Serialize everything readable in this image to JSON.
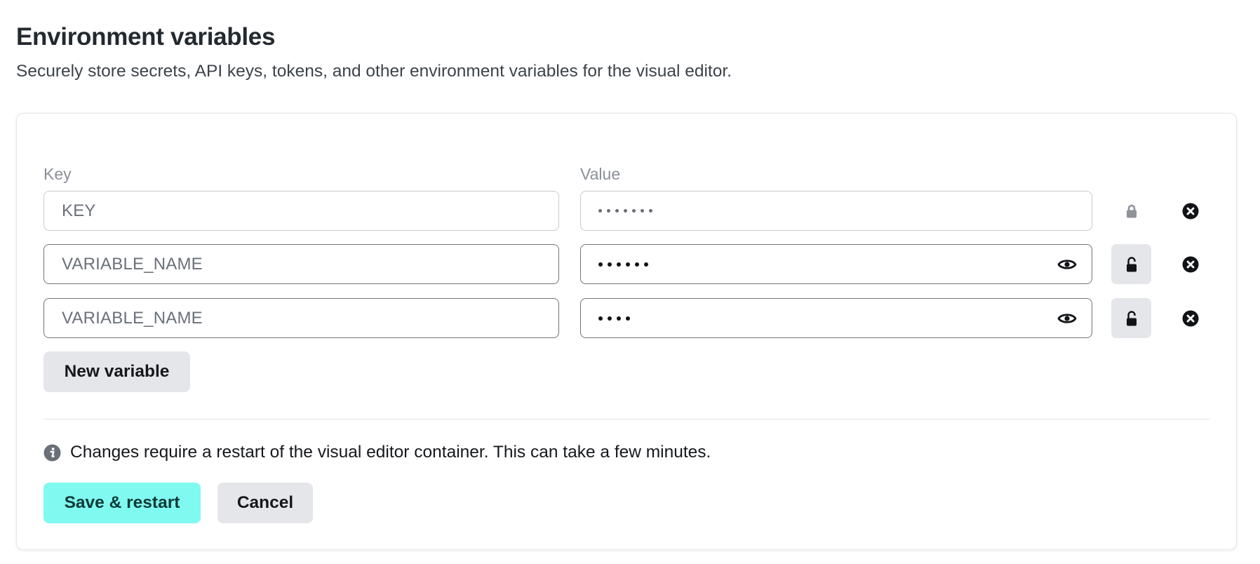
{
  "header": {
    "title": "Environment variables",
    "subtitle": "Securely store secrets, API keys, tokens, and other environment variables for the visual editor."
  },
  "columns": {
    "key_label": "Key",
    "value_label": "Value"
  },
  "rows": [
    {
      "key_value": "KEY",
      "key_placeholder": "",
      "value_masked_length": 7,
      "state": "disabled",
      "lock_icon": "lock-closed-icon",
      "show_toggle": false
    },
    {
      "key_value": "",
      "key_placeholder": "VARIABLE_NAME",
      "value_masked_length": 6,
      "state": "editable",
      "lock_icon": "lock-open-icon",
      "show_toggle": true
    },
    {
      "key_value": "",
      "key_placeholder": "VARIABLE_NAME",
      "value_masked_length": 4,
      "state": "editable",
      "lock_icon": "lock-open-icon",
      "show_toggle": true
    }
  ],
  "actions": {
    "new_variable_label": "New variable",
    "save_label": "Save & restart",
    "cancel_label": "Cancel"
  },
  "notice": {
    "icon": "info-icon",
    "text": "Changes require a restart of the visual editor container. This can take a few minutes."
  },
  "colors": {
    "primary": "#80faf0",
    "primary_text": "#0d3a37",
    "secondary": "#e5e6ea"
  }
}
